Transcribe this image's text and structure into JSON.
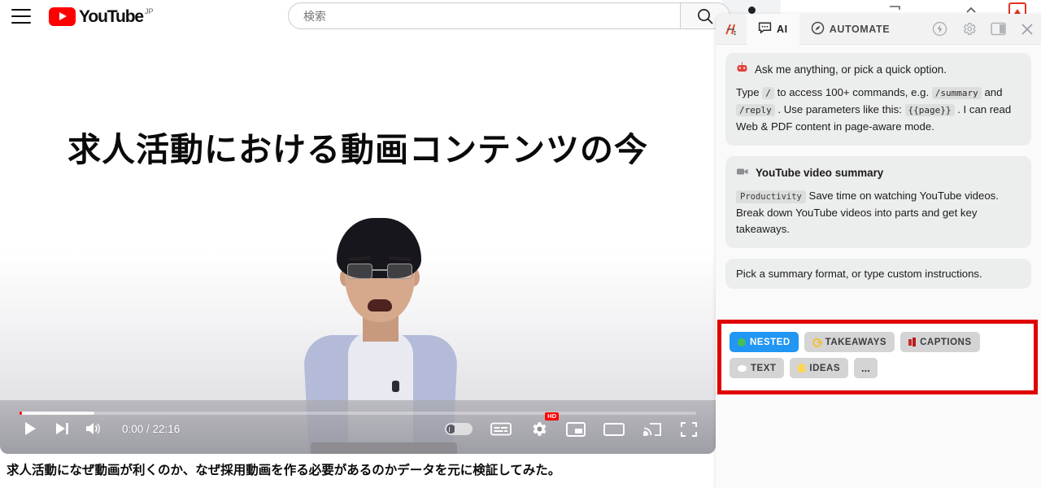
{
  "browser": {
    "download_icon": "download-icon",
    "caret_icon": "chevron-up-icon",
    "extension_icon": "extension-icon"
  },
  "youtube": {
    "menu_icon": "hamburger-menu-icon",
    "logo_text": "YouTube",
    "logo_country": "JP",
    "search": {
      "value": "",
      "placeholder": "検索",
      "button_icon": "search-icon"
    },
    "video": {
      "slide_title": "求人活動における動画コンテンツの今",
      "caption": "求人活動になぜ動画が利くのか、なぜ採用動画を作る必要があるのかデータを元に検証してみた。",
      "controls": {
        "play_icon": "play-icon",
        "next_icon": "next-video-icon",
        "volume_icon": "volume-icon",
        "time": "0:00 / 22:16",
        "autoplay_icon": "autoplay-toggle",
        "subtitles_icon": "subtitles-icon",
        "settings_icon": "settings-gear-icon",
        "quality_badge": "HD",
        "miniplayer_icon": "miniplayer-icon",
        "theater_icon": "theater-mode-icon",
        "cast_icon": "cast-icon",
        "fullscreen_icon": "fullscreen-icon"
      },
      "progress": {
        "played_percent": 0,
        "buffered_percent": 11
      }
    }
  },
  "ai_panel": {
    "brand_icon": "brand-logo-icon",
    "tabs": [
      {
        "label": "AI",
        "icon": "chat-bubble-icon",
        "active": true
      },
      {
        "label": "AUTOMATE",
        "icon": "compass-icon",
        "active": false
      }
    ],
    "actions": [
      {
        "name": "lightning-icon"
      },
      {
        "name": "gear-icon"
      },
      {
        "name": "panel-layout-icon"
      },
      {
        "name": "close-icon"
      }
    ],
    "intro_card": {
      "icon": "robot-icon",
      "headline": "Ask me anything, or pick a quick option.",
      "body_1": "Type",
      "code_1": "/",
      "body_2": "to access 100+ commands, e.g.",
      "code_2": "/summary",
      "body_3": "and",
      "code_3": "/reply",
      "body_4": ". Use parameters like this:",
      "code_4": "{{page}}",
      "body_5": ". I can read Web & PDF content in page-aware mode."
    },
    "summary_card": {
      "icon": "video-camera-icon",
      "title": "YouTube video summary",
      "tag": "Productivity",
      "description": "Save time on watching YouTube videos. Break down YouTube videos into parts and get key takeaways."
    },
    "prompt_card": {
      "text": "Pick a summary format, or type custom instructions."
    },
    "format_chips": [
      {
        "label": "NESTED",
        "icon": "recycle-icon",
        "active": true
      },
      {
        "label": "TAKEAWAYS",
        "icon": "key-icon",
        "active": false
      },
      {
        "label": "CAPTIONS",
        "icon": "captions-icon",
        "active": false
      },
      {
        "label": "TEXT",
        "icon": "speech-bubble-icon",
        "active": false
      },
      {
        "label": "IDEAS",
        "icon": "lightbulb-icon",
        "active": false
      },
      {
        "label": "...",
        "icon": "more-icon",
        "active": false
      }
    ],
    "highlight": {
      "color": "#e00000"
    }
  }
}
